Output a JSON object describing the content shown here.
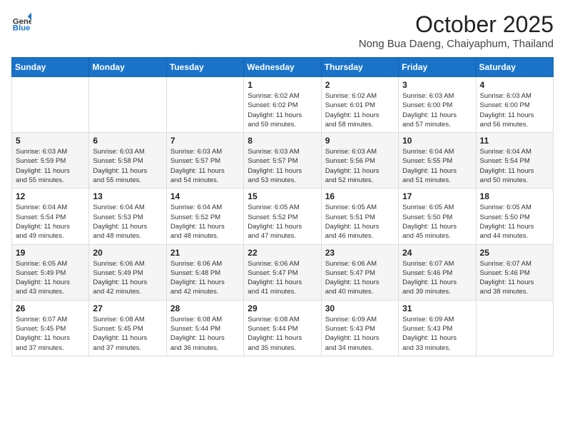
{
  "logo": {
    "general": "General",
    "blue": "Blue"
  },
  "header": {
    "month": "October 2025",
    "location": "Nong Bua Daeng, Chaiyaphum, Thailand"
  },
  "weekdays": [
    "Sunday",
    "Monday",
    "Tuesday",
    "Wednesday",
    "Thursday",
    "Friday",
    "Saturday"
  ],
  "weeks": [
    [
      {
        "day": "",
        "info": ""
      },
      {
        "day": "",
        "info": ""
      },
      {
        "day": "",
        "info": ""
      },
      {
        "day": "1",
        "info": "Sunrise: 6:02 AM\nSunset: 6:02 PM\nDaylight: 11 hours\nand 59 minutes."
      },
      {
        "day": "2",
        "info": "Sunrise: 6:02 AM\nSunset: 6:01 PM\nDaylight: 11 hours\nand 58 minutes."
      },
      {
        "day": "3",
        "info": "Sunrise: 6:03 AM\nSunset: 6:00 PM\nDaylight: 11 hours\nand 57 minutes."
      },
      {
        "day": "4",
        "info": "Sunrise: 6:03 AM\nSunset: 6:00 PM\nDaylight: 11 hours\nand 56 minutes."
      }
    ],
    [
      {
        "day": "5",
        "info": "Sunrise: 6:03 AM\nSunset: 5:59 PM\nDaylight: 11 hours\nand 55 minutes."
      },
      {
        "day": "6",
        "info": "Sunrise: 6:03 AM\nSunset: 5:58 PM\nDaylight: 11 hours\nand 55 minutes."
      },
      {
        "day": "7",
        "info": "Sunrise: 6:03 AM\nSunset: 5:57 PM\nDaylight: 11 hours\nand 54 minutes."
      },
      {
        "day": "8",
        "info": "Sunrise: 6:03 AM\nSunset: 5:57 PM\nDaylight: 11 hours\nand 53 minutes."
      },
      {
        "day": "9",
        "info": "Sunrise: 6:03 AM\nSunset: 5:56 PM\nDaylight: 11 hours\nand 52 minutes."
      },
      {
        "day": "10",
        "info": "Sunrise: 6:04 AM\nSunset: 5:55 PM\nDaylight: 11 hours\nand 51 minutes."
      },
      {
        "day": "11",
        "info": "Sunrise: 6:04 AM\nSunset: 5:54 PM\nDaylight: 11 hours\nand 50 minutes."
      }
    ],
    [
      {
        "day": "12",
        "info": "Sunrise: 6:04 AM\nSunset: 5:54 PM\nDaylight: 11 hours\nand 49 minutes."
      },
      {
        "day": "13",
        "info": "Sunrise: 6:04 AM\nSunset: 5:53 PM\nDaylight: 11 hours\nand 48 minutes."
      },
      {
        "day": "14",
        "info": "Sunrise: 6:04 AM\nSunset: 5:52 PM\nDaylight: 11 hours\nand 48 minutes."
      },
      {
        "day": "15",
        "info": "Sunrise: 6:05 AM\nSunset: 5:52 PM\nDaylight: 11 hours\nand 47 minutes."
      },
      {
        "day": "16",
        "info": "Sunrise: 6:05 AM\nSunset: 5:51 PM\nDaylight: 11 hours\nand 46 minutes."
      },
      {
        "day": "17",
        "info": "Sunrise: 6:05 AM\nSunset: 5:50 PM\nDaylight: 11 hours\nand 45 minutes."
      },
      {
        "day": "18",
        "info": "Sunrise: 6:05 AM\nSunset: 5:50 PM\nDaylight: 11 hours\nand 44 minutes."
      }
    ],
    [
      {
        "day": "19",
        "info": "Sunrise: 6:05 AM\nSunset: 5:49 PM\nDaylight: 11 hours\nand 43 minutes."
      },
      {
        "day": "20",
        "info": "Sunrise: 6:06 AM\nSunset: 5:49 PM\nDaylight: 11 hours\nand 42 minutes."
      },
      {
        "day": "21",
        "info": "Sunrise: 6:06 AM\nSunset: 5:48 PM\nDaylight: 11 hours\nand 42 minutes."
      },
      {
        "day": "22",
        "info": "Sunrise: 6:06 AM\nSunset: 5:47 PM\nDaylight: 11 hours\nand 41 minutes."
      },
      {
        "day": "23",
        "info": "Sunrise: 6:06 AM\nSunset: 5:47 PM\nDaylight: 11 hours\nand 40 minutes."
      },
      {
        "day": "24",
        "info": "Sunrise: 6:07 AM\nSunset: 5:46 PM\nDaylight: 11 hours\nand 39 minutes."
      },
      {
        "day": "25",
        "info": "Sunrise: 6:07 AM\nSunset: 5:46 PM\nDaylight: 11 hours\nand 38 minutes."
      }
    ],
    [
      {
        "day": "26",
        "info": "Sunrise: 6:07 AM\nSunset: 5:45 PM\nDaylight: 11 hours\nand 37 minutes."
      },
      {
        "day": "27",
        "info": "Sunrise: 6:08 AM\nSunset: 5:45 PM\nDaylight: 11 hours\nand 37 minutes."
      },
      {
        "day": "28",
        "info": "Sunrise: 6:08 AM\nSunset: 5:44 PM\nDaylight: 11 hours\nand 36 minutes."
      },
      {
        "day": "29",
        "info": "Sunrise: 6:08 AM\nSunset: 5:44 PM\nDaylight: 11 hours\nand 35 minutes."
      },
      {
        "day": "30",
        "info": "Sunrise: 6:09 AM\nSunset: 5:43 PM\nDaylight: 11 hours\nand 34 minutes."
      },
      {
        "day": "31",
        "info": "Sunrise: 6:09 AM\nSunset: 5:43 PM\nDaylight: 11 hours\nand 33 minutes."
      },
      {
        "day": "",
        "info": ""
      }
    ]
  ]
}
